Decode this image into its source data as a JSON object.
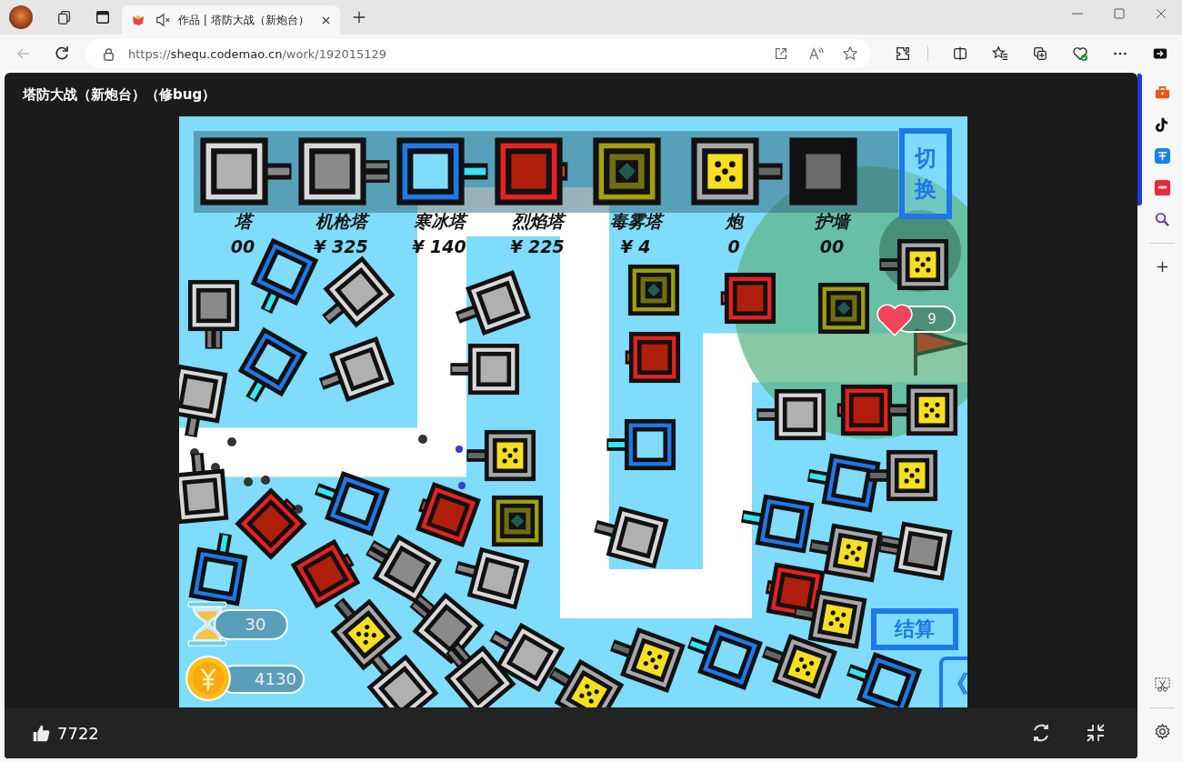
{
  "browser": {
    "tab": {
      "title": "作品 | 塔防大战（新炮台）",
      "selected": true
    },
    "url": {
      "scheme": "https://",
      "host": "shequ.codemao.cn",
      "path": "/work/192015129"
    }
  },
  "page": {
    "title": "塔防大战（新炮台）（修bug）"
  },
  "game": {
    "shop": [
      {
        "kind": "basic",
        "label": "塔",
        "price": "00"
      },
      {
        "kind": "gun",
        "label": "机枪塔",
        "price": "¥ 325"
      },
      {
        "kind": "ice",
        "label": "寒冰塔",
        "price": "¥ 140"
      },
      {
        "kind": "fire",
        "label": "烈焰塔",
        "price": "¥ 225"
      },
      {
        "kind": "poison",
        "label": "毒雾塔",
        "price": "¥ 4"
      },
      {
        "kind": "mortar",
        "label": "炮",
        "price": "0"
      },
      {
        "kind": "wall",
        "label": "护墙",
        "price": "00"
      }
    ],
    "switch_button": "切换",
    "settle_button": "结算",
    "collapse_button": "《",
    "timer": "30",
    "coins": "4130",
    "lives": "9"
  },
  "footer": {
    "likes": "7722"
  }
}
